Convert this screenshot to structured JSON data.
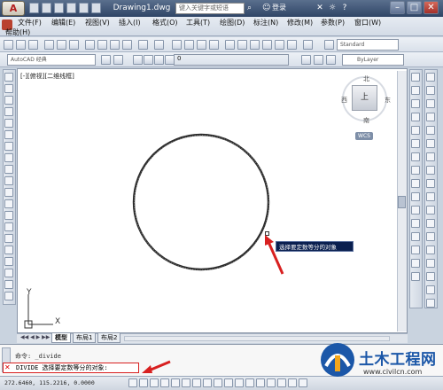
{
  "window": {
    "title": "Drawing1.dwg",
    "search_placeholder": "键入关键字或短语",
    "login_label": "登录"
  },
  "menu": {
    "items": [
      "文件(F)",
      "编辑(E)",
      "视图(V)",
      "插入(I)",
      "格式(O)",
      "工具(T)",
      "绘图(D)",
      "标注(N)",
      "修改(M)",
      "参数(P)",
      "窗口(W)"
    ],
    "help": "帮助(H)"
  },
  "toolbar": {
    "workspace": "AutoCAD 经典",
    "text_style": "Standard",
    "layer_value": "ByLayer",
    "layer_number": "0"
  },
  "viewport": {
    "label": "[-][俯视][二维线框]",
    "tooltip": "选择要定数等分的对象"
  },
  "viewcube": {
    "north": "北",
    "south": "南",
    "east": "东",
    "west": "西",
    "face": "上",
    "wcs": "WCS"
  },
  "ucs": {
    "x": "X",
    "y": "Y"
  },
  "tabs": [
    "模型",
    "布局1",
    "布局2"
  ],
  "command": {
    "history": "命令: _divide",
    "current": "DIVIDE 选择要定数等分的对象:"
  },
  "status": {
    "coords": "272.6460, 115.2216, 0.0000"
  },
  "watermark": {
    "name": "土木工程网",
    "url": "www.civilcn.com"
  },
  "colors": {
    "accent_red": "#d82020",
    "tooltip_bg": "#0a1f4f",
    "watermark_blue": "#1b57a8"
  }
}
